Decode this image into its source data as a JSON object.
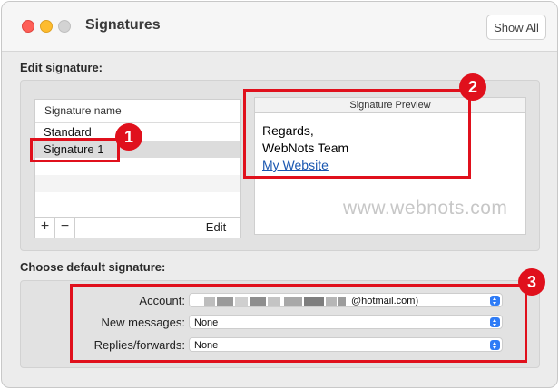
{
  "window": {
    "title": "Signatures",
    "show_all_label": "Show All"
  },
  "edit_section": {
    "label": "Edit signature:",
    "list_header": "Signature name",
    "signatures": [
      "Standard",
      "Signature 1"
    ],
    "selected_index": 1,
    "add_label": "+",
    "remove_label": "−",
    "edit_label": "Edit"
  },
  "preview": {
    "header": "Signature Preview",
    "line1": "Regards,",
    "line2": "WebNots Team",
    "link": "My Website"
  },
  "watermark": "www.webnots.com",
  "default_section": {
    "label": "Choose default signature:",
    "account_label": "Account:",
    "account_value": "@hotmail.com)",
    "new_messages_label": "New messages:",
    "new_messages_value": "None",
    "replies_label": "Replies/forwards:",
    "replies_value": "None"
  },
  "annotations": {
    "badge1": "1",
    "badge2": "2",
    "badge3": "3"
  },
  "colors": {
    "accent": "#2f7cf6",
    "annotation_red": "#e0101c",
    "link": "#1a57b0"
  },
  "icons": [
    "close-light",
    "minimize-light",
    "zoom-light",
    "popup-chevron-icon"
  ]
}
